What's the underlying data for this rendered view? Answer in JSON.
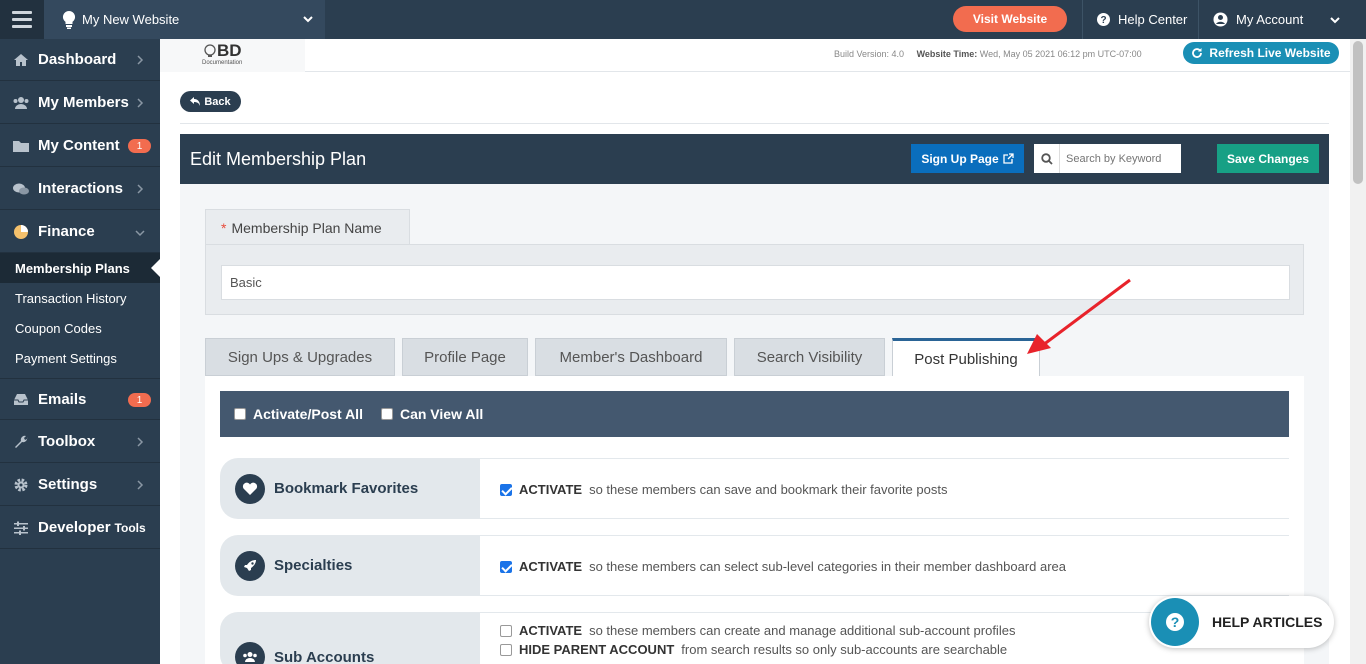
{
  "topbar": {
    "site_name": "My New Website",
    "visit_label": "Visit Website",
    "help_label": "Help Center",
    "account_label": "My Account"
  },
  "sidebar": {
    "items": [
      {
        "label": "Dashboard",
        "icon": "home-icon"
      },
      {
        "label": "My Members",
        "icon": "users-icon"
      },
      {
        "label": "My Content",
        "icon": "folder-icon",
        "badge": "1"
      },
      {
        "label": "Interactions",
        "icon": "comments-icon"
      },
      {
        "label": "Finance",
        "icon": "pie-chart-icon"
      },
      {
        "label": "Emails",
        "icon": "inbox-icon",
        "badge": "1"
      },
      {
        "label": "Toolbox",
        "icon": "wrench-icon"
      },
      {
        "label": "Settings",
        "icon": "gear-icon"
      },
      {
        "label": "Developer",
        "suffix": "Tools",
        "icon": "sliders-icon"
      }
    ],
    "sub_items": [
      "Membership Plans",
      "Transaction History",
      "Coupon Codes",
      "Payment Settings"
    ]
  },
  "subheader": {
    "logo_text": "BD",
    "logo_sub": "Documentation",
    "build_label": "Build Version: 4.0",
    "time_label": "Website Time:",
    "time_value": "Wed, May 05 2021 06:12 pm UTC-07:00",
    "refresh_label": "Refresh Live Website"
  },
  "page": {
    "back_label": "Back",
    "title": "Edit Membership Plan",
    "signup_label": "Sign Up Page",
    "search_placeholder": "Search by Keyword",
    "save_label": "Save Changes"
  },
  "plan_name": {
    "label": "Membership Plan Name",
    "required_mark": "*",
    "value": "Basic"
  },
  "tabs": [
    "Sign Ups & Upgrades",
    "Profile Page",
    "Member's Dashboard",
    "Search Visibility",
    "Post Publishing"
  ],
  "bulk": {
    "activate_all": "Activate/Post All",
    "view_all": "Can View All"
  },
  "features": [
    {
      "name": "Bookmark Favorites",
      "icon": "heart-icon",
      "options": [
        {
          "bold": "ACTIVATE",
          "text": "so these members can save and bookmark their favorite posts",
          "checked": true
        }
      ]
    },
    {
      "name": "Specialties",
      "icon": "rocket-icon",
      "options": [
        {
          "bold": "ACTIVATE",
          "text": "so these members can select sub-level categories in their member dashboard area",
          "checked": true
        }
      ]
    },
    {
      "name": "Sub Accounts",
      "icon": "users-icon",
      "options": [
        {
          "bold": "ACTIVATE",
          "text": "so these members can create and manage additional sub-account profiles",
          "checked": false
        },
        {
          "bold": "HIDE PARENT ACCOUNT",
          "text": "from search results so only sub-accounts are searchable",
          "checked": false
        }
      ]
    }
  ],
  "help_widget": {
    "label": "HELP ARTICLES"
  },
  "colors": {
    "accent": "#f26c4f",
    "nav": "#2b3e50",
    "teal": "#17a085",
    "blue": "#0a6ebd"
  }
}
